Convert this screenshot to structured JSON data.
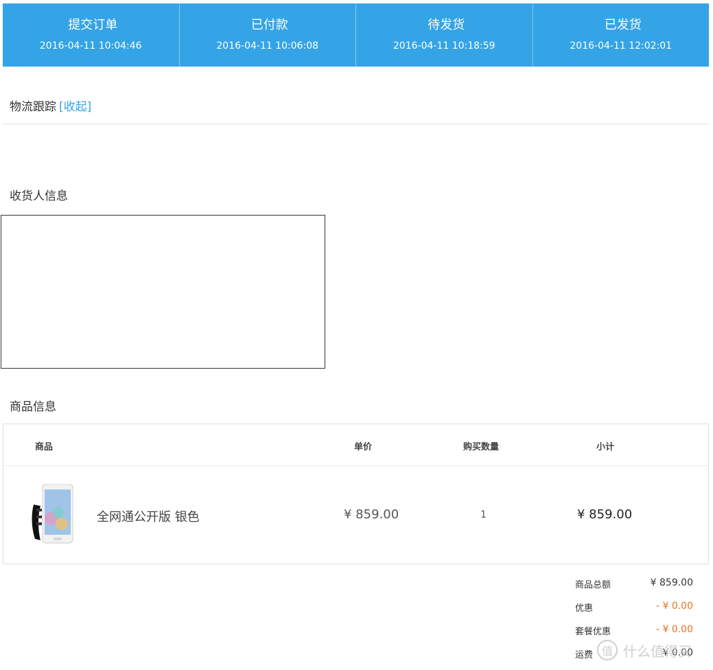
{
  "steps": [
    {
      "title": "提交订单",
      "time": "2016-04-11 10:04:46"
    },
    {
      "title": "已付款",
      "time": "2016-04-11 10:06:08"
    },
    {
      "title": "待发货",
      "time": "2016-04-11 10:18:59"
    },
    {
      "title": "已发货",
      "time": "2016-04-11 12:02:01"
    }
  ],
  "logistics": {
    "title": "物流跟踪",
    "toggle": "[收起]"
  },
  "receiver": {
    "title": "收货人信息"
  },
  "products": {
    "title": "商品信息",
    "headers": {
      "product": "商品",
      "unit_price": "单价",
      "quantity": "购买数量",
      "subtotal": "小计"
    },
    "rows": [
      {
        "name": "全网通公开版 银色",
        "unit_price": "¥ 859.00",
        "quantity": "1",
        "subtotal": "¥ 859.00"
      }
    ]
  },
  "summary": [
    {
      "label": "商品总额",
      "value": "¥ 859.00"
    },
    {
      "label": "优惠",
      "value": "- ¥ 0.00"
    },
    {
      "label": "套餐优惠",
      "value": "- ¥ 0.00"
    },
    {
      "label": "运费",
      "value": "¥ 0.00"
    }
  ],
  "watermark": {
    "text": "什么值得买",
    "symbol": "值"
  },
  "colors": {
    "accent": "#35a4e6",
    "discount": "#e8731c"
  }
}
